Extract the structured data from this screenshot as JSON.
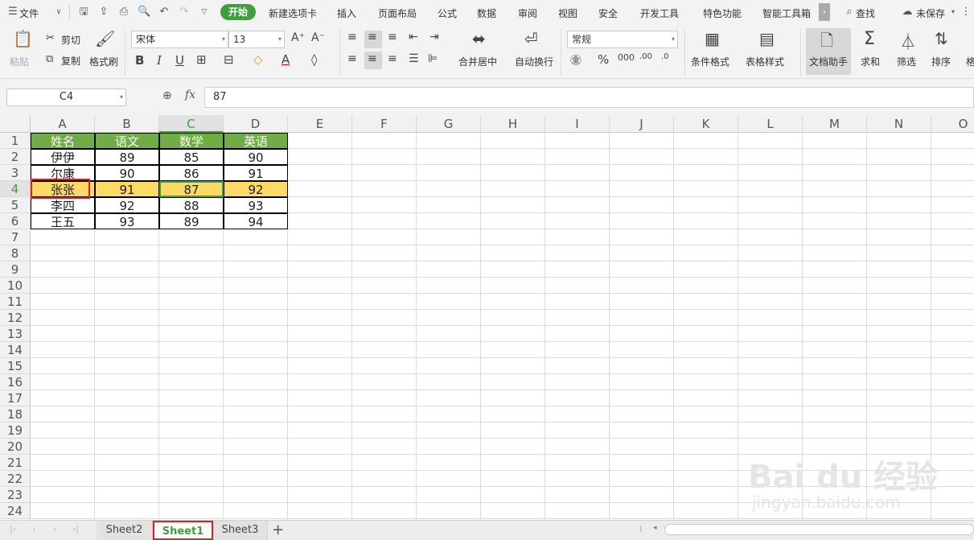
{
  "menu": {
    "file": "文件",
    "start": "开始",
    "items": [
      "新建选项卡",
      "插入",
      "页面布局",
      "公式",
      "数据",
      "审阅",
      "视图",
      "安全",
      "开发工具",
      "特色功能",
      "智能工具箱"
    ],
    "search": "查找",
    "save_status": "未保存"
  },
  "ribbon": {
    "paste": "粘贴",
    "cut": "剪切",
    "copy": "复制",
    "format_painter": "格式刷",
    "font_name": "宋体",
    "font_size": "13",
    "number_format": "常规",
    "merge_center": "合并居中",
    "auto_wrap": "自动换行",
    "cond_format": "条件格式",
    "table_style": "表格样式",
    "doc_assistant": "文档助手",
    "sum": "求和",
    "filter": "筛选",
    "sort": "排序",
    "more": "格"
  },
  "formula": {
    "cell_ref": "C4",
    "fx": "fx",
    "value": "87"
  },
  "columns": [
    "A",
    "B",
    "C",
    "D",
    "E",
    "F",
    "G",
    "H",
    "I",
    "J",
    "K",
    "L",
    "M",
    "N",
    "O"
  ],
  "rows": [
    "1",
    "2",
    "3",
    "4",
    "5",
    "6",
    "7",
    "8",
    "9",
    "10",
    "11",
    "12",
    "13",
    "14",
    "15",
    "16",
    "17",
    "18",
    "19",
    "20",
    "21",
    "22",
    "23",
    "24"
  ],
  "table": {
    "headers": [
      "姓名",
      "语文",
      "数学",
      "英语"
    ],
    "rows": [
      [
        "伊伊",
        "89",
        "85",
        "90"
      ],
      [
        "尔康",
        "90",
        "86",
        "91"
      ],
      [
        "张张",
        "91",
        "87",
        "92"
      ],
      [
        "李四",
        "92",
        "88",
        "93"
      ],
      [
        "王五",
        "93",
        "89",
        "94"
      ]
    ]
  },
  "sheets": [
    "Sheet2",
    "Sheet1",
    "Sheet3"
  ],
  "watermark": {
    "brand": "Bai du 经验",
    "url": "jingyan.baidu.com"
  },
  "colors": {
    "header_green": "#70ad47",
    "highlight_row": "#ffd966",
    "selection_red": "#e02020",
    "accent_green": "#3f9f3f"
  }
}
